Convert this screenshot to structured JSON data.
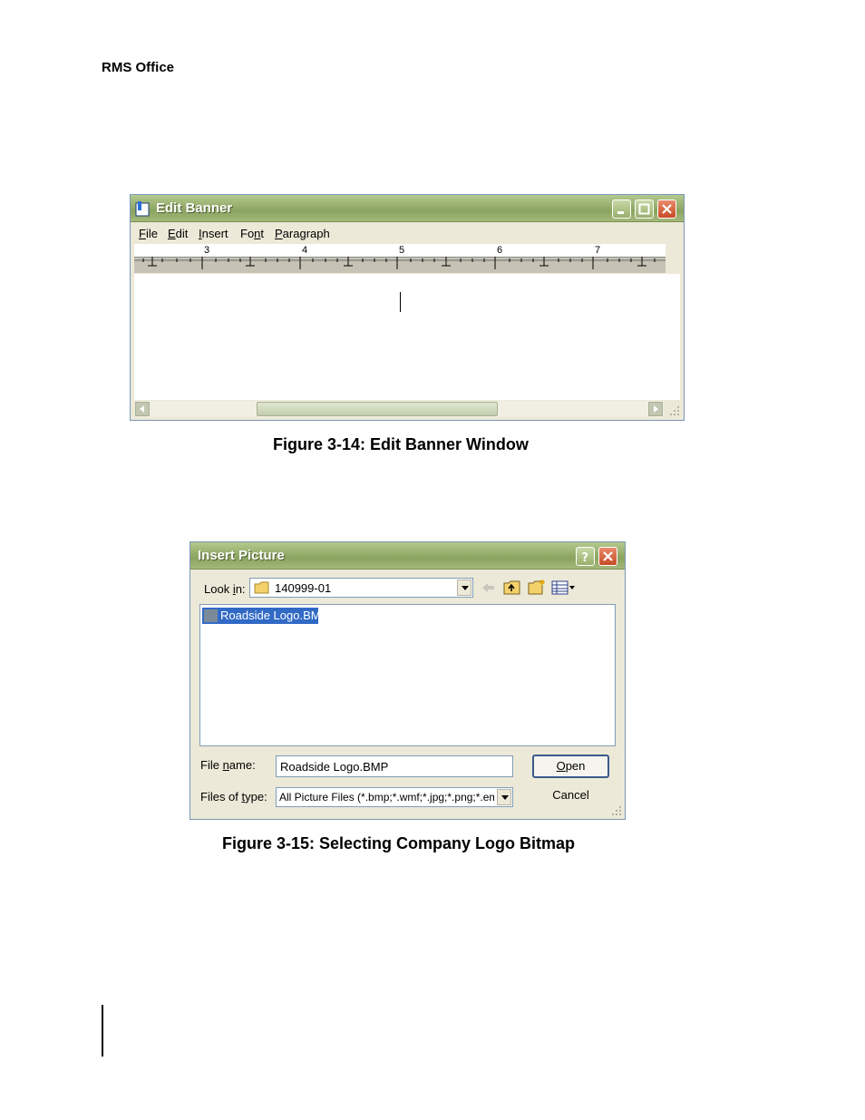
{
  "document": {
    "header": "RMS Office"
  },
  "figure_1": {
    "caption": "Figure 3-14: Edit Banner Window",
    "window": {
      "title": "Edit Banner",
      "menu": [
        {
          "key": "F",
          "rest": "ile"
        },
        {
          "key": "E",
          "rest": "dit"
        },
        {
          "key": "I",
          "rest": "nsert"
        },
        {
          "pre": "Fo",
          "key": "n",
          "rest": "t"
        },
        {
          "key": "P",
          "rest": "aragraph"
        }
      ],
      "ruler_numbers": [
        "3",
        "4",
        "5",
        "6",
        "7"
      ]
    }
  },
  "figure_2": {
    "caption": "Figure 3-15: Selecting Company Logo Bitmap",
    "dialog": {
      "title": "Insert Picture",
      "look_in_label_pre": "Look ",
      "look_in_label_key": "i",
      "look_in_label_post": "n:",
      "look_in_value": "140999-01",
      "files": [
        "Roadside Logo.BMP"
      ],
      "file_name_label_pre": "File ",
      "file_name_label_key": "n",
      "file_name_label_post": "ame:",
      "file_name_value": "Roadside Logo.BMP",
      "files_of_type_label_pre": "Files of ",
      "files_of_type_label_key": "t",
      "files_of_type_label_post": "ype:",
      "files_of_type_value": "All Picture Files (*.bmp;*.wmf;*.jpg;*.png;*.em",
      "open_key": "O",
      "open_rest": "pen",
      "cancel_label": "Cancel"
    }
  }
}
